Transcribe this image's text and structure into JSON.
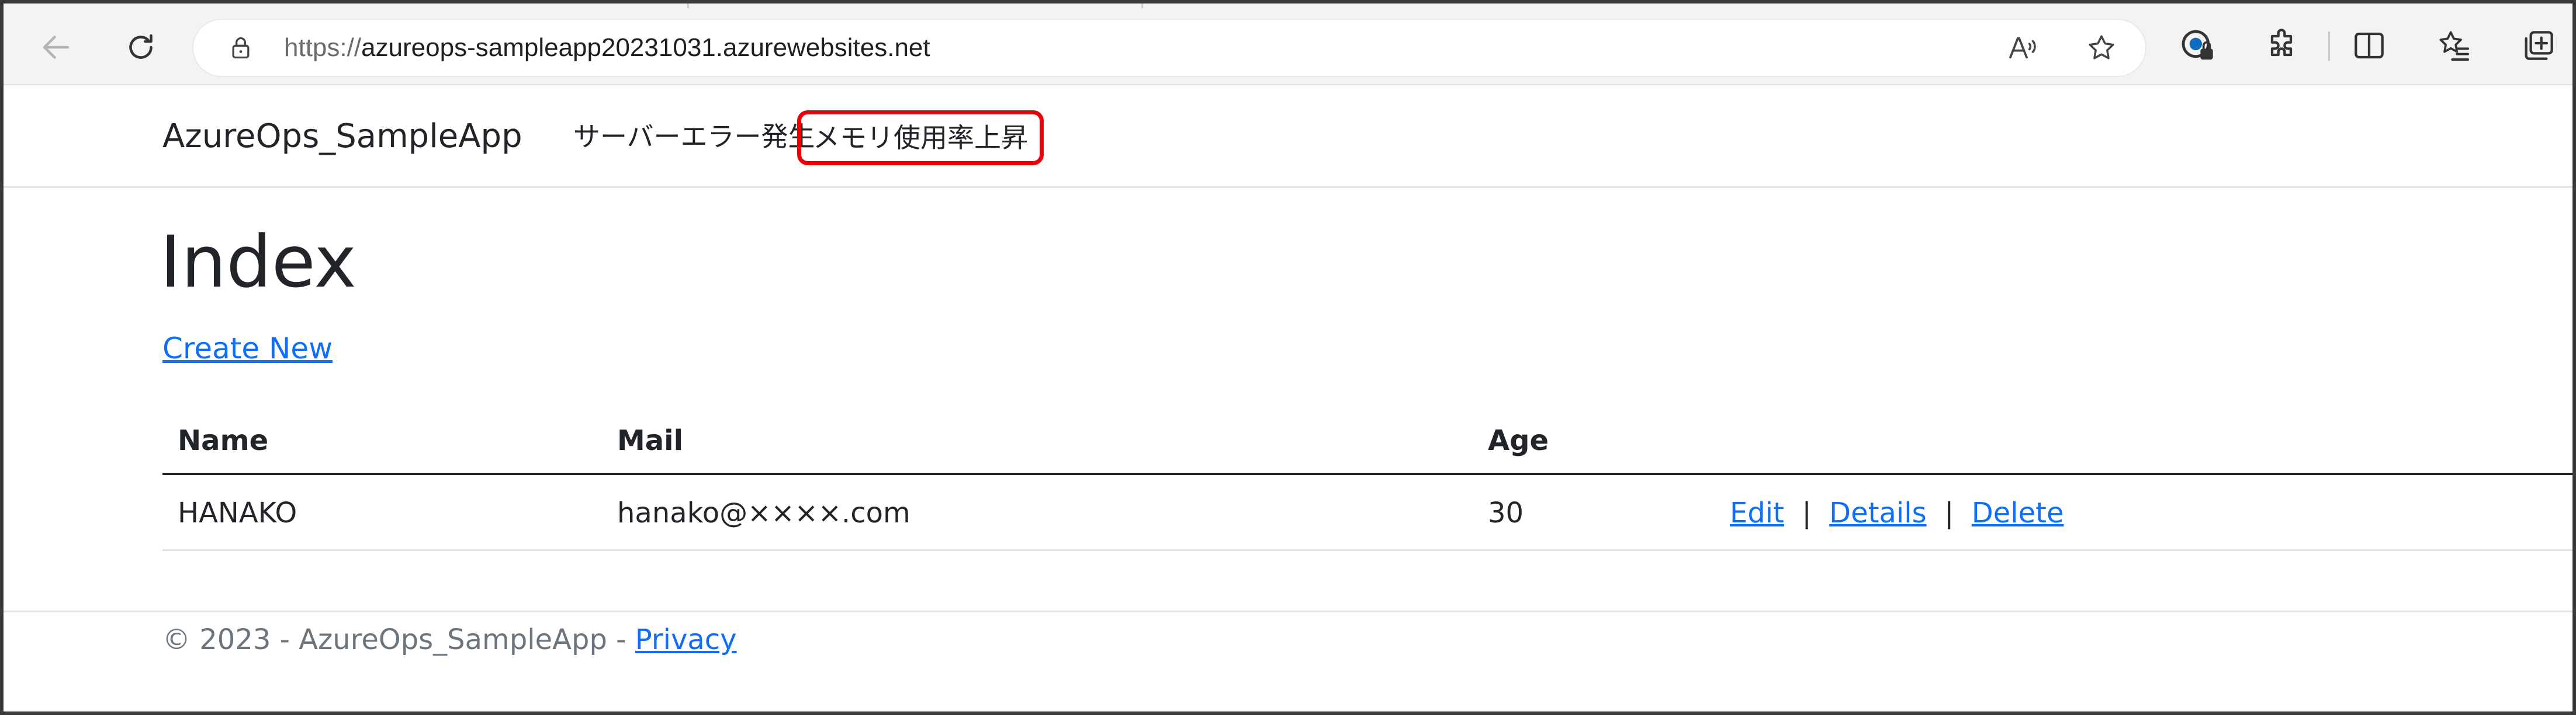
{
  "browser": {
    "url_scheme": "https://",
    "url_host": "azureops-sampleapp20231031.azurewebsites.net"
  },
  "navbar": {
    "brand": "AzureOps_SampleApp",
    "links": [
      {
        "label": "サーバーエラー発生"
      },
      {
        "label": "メモリ使用率上昇"
      }
    ],
    "highlight_color": "#e8000b"
  },
  "main": {
    "title": "Index",
    "create_link": "Create New",
    "table": {
      "headers": [
        "Name",
        "Mail",
        "Age"
      ],
      "rows": [
        {
          "name": "HANAKO",
          "mail": "hanako@××××.com",
          "age": "30",
          "actions": [
            "Edit",
            "Details",
            "Delete"
          ]
        }
      ],
      "action_separator": "|"
    }
  },
  "footer": {
    "text": "© 2023 - AzureOps_SampleApp - ",
    "link": "Privacy"
  },
  "colors": {
    "link": "#0d6efd",
    "text": "#212529",
    "muted": "#6c757d"
  }
}
